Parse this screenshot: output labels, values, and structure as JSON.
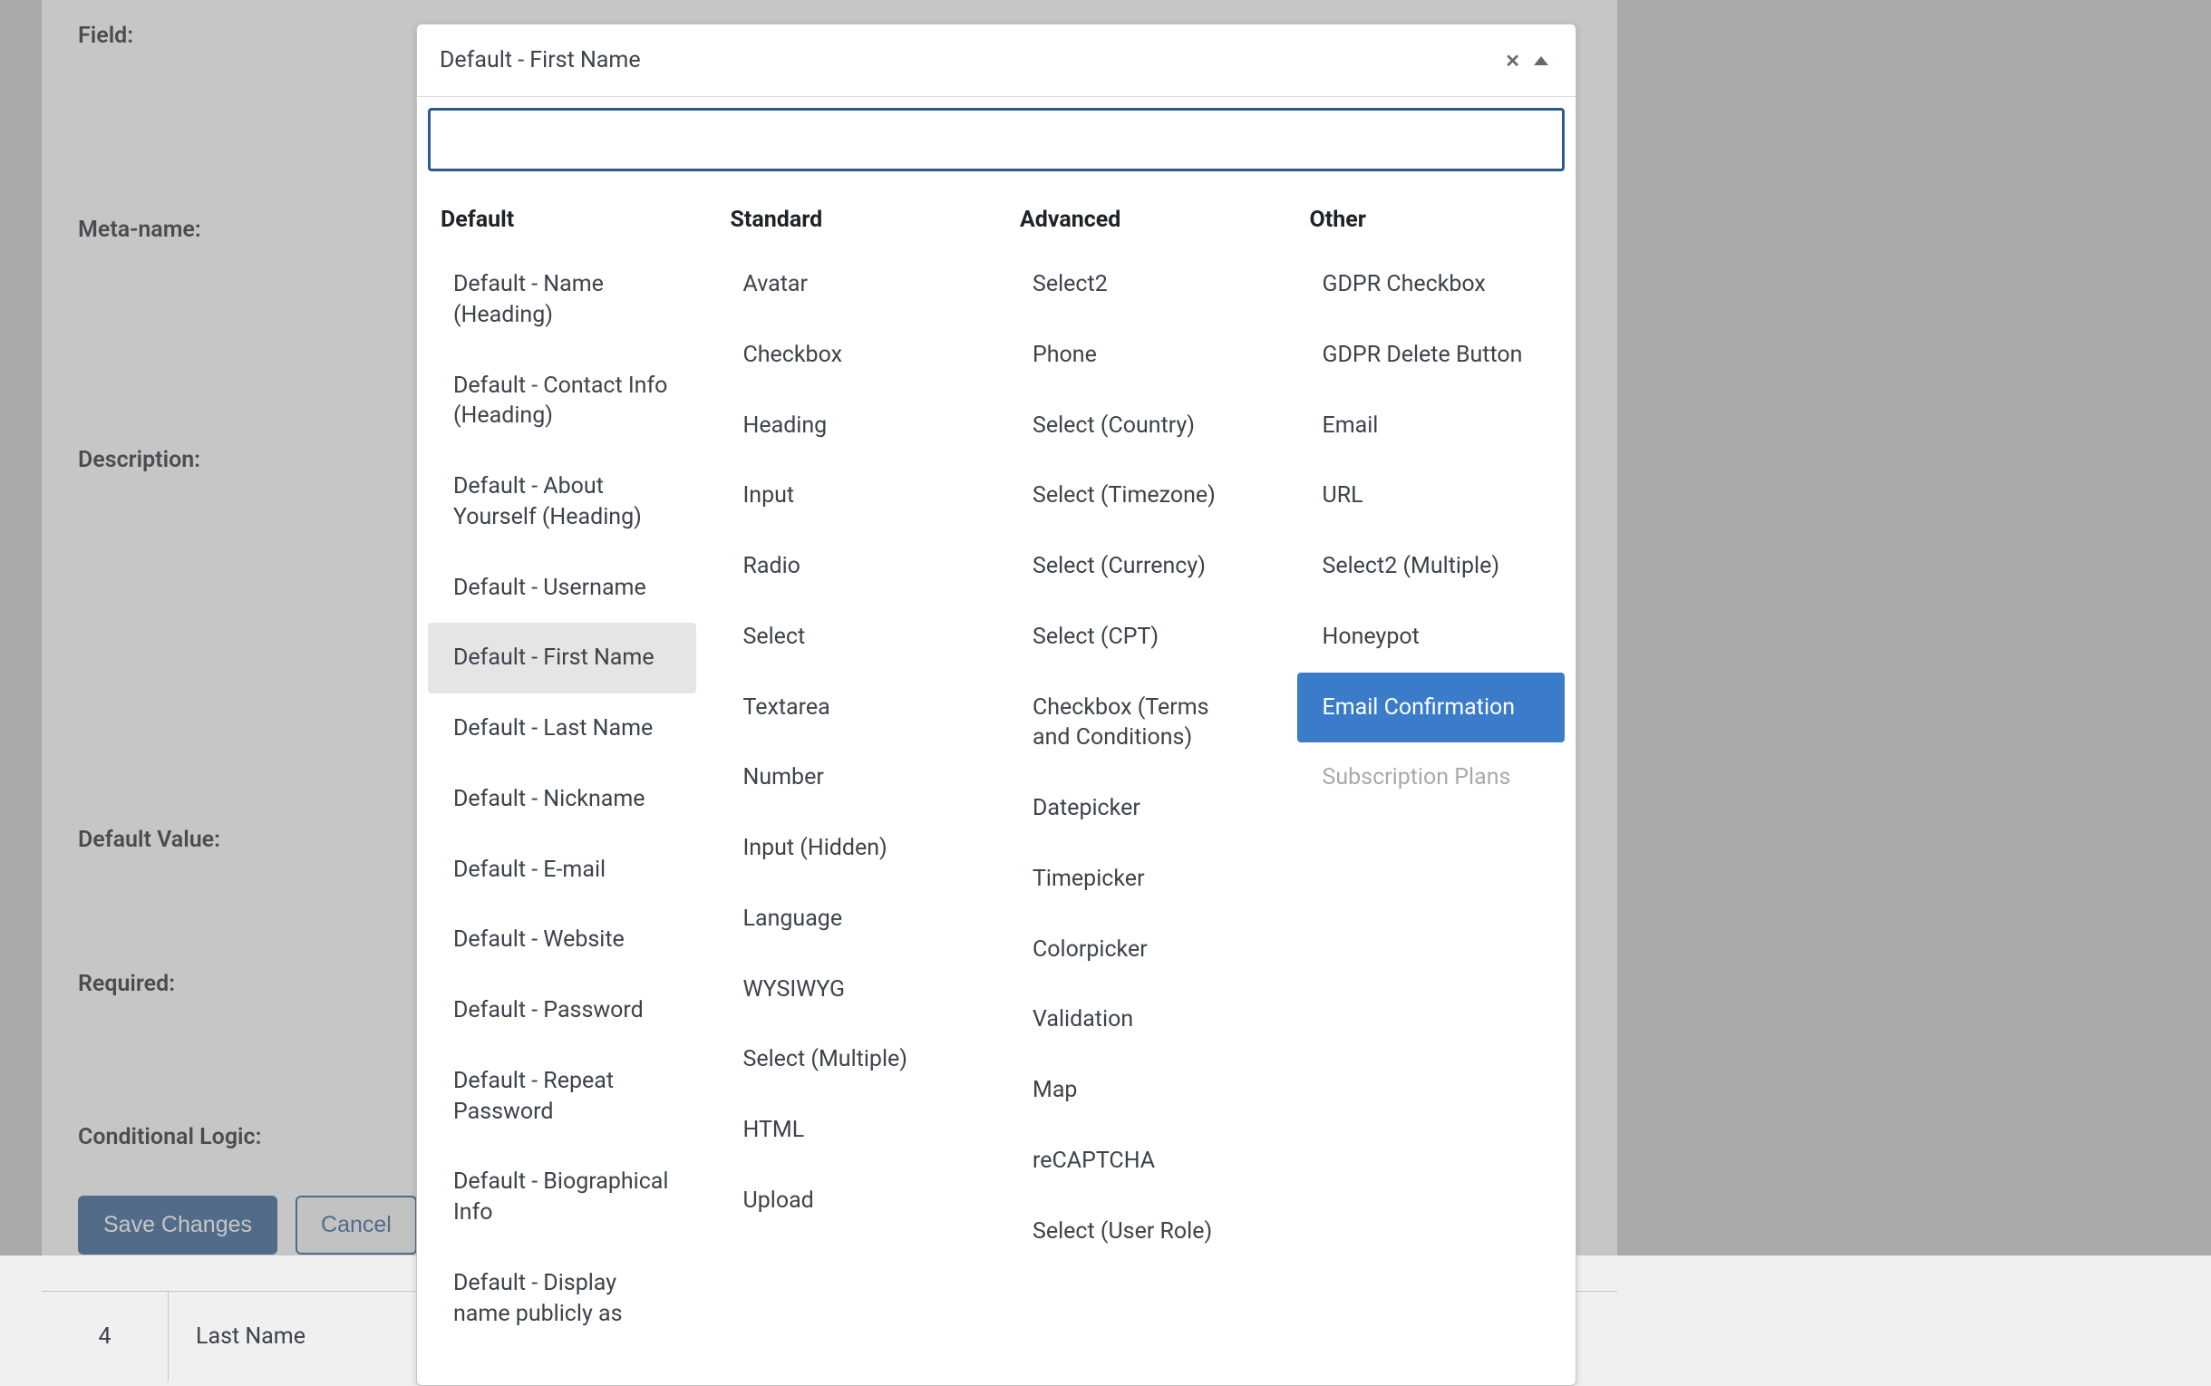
{
  "form": {
    "field_label": "Field:",
    "meta_label": "Meta-name:",
    "description_label": "Description:",
    "default_value_label": "Default Value:",
    "required_label": "Required:",
    "conditional_logic_label": "Conditional Logic:",
    "save_button": "Save Changes",
    "cancel_button": "Cancel"
  },
  "table": {
    "row_num": "4",
    "row_name": "Last Name"
  },
  "dropdown": {
    "current_value": "Default - First Name",
    "search_value": "",
    "columns": [
      {
        "header": "Default",
        "items": [
          {
            "label": "Default - Name (Heading)",
            "state": "normal"
          },
          {
            "label": "Default - Contact Info (Heading)",
            "state": "normal"
          },
          {
            "label": "Default - About Yourself (Heading)",
            "state": "normal"
          },
          {
            "label": "Default - Username",
            "state": "normal"
          },
          {
            "label": "Default - First Name",
            "state": "selected"
          },
          {
            "label": "Default - Last Name",
            "state": "normal"
          },
          {
            "label": "Default - Nickname",
            "state": "normal"
          },
          {
            "label": "Default - E-mail",
            "state": "normal"
          },
          {
            "label": "Default - Website",
            "state": "normal"
          },
          {
            "label": "Default - Password",
            "state": "normal"
          },
          {
            "label": "Default - Repeat Password",
            "state": "normal"
          },
          {
            "label": "Default - Biographical Info",
            "state": "normal"
          },
          {
            "label": "Default - Display name publicly as",
            "state": "normal"
          }
        ]
      },
      {
        "header": "Standard",
        "items": [
          {
            "label": "Avatar",
            "state": "normal"
          },
          {
            "label": "Checkbox",
            "state": "normal"
          },
          {
            "label": "Heading",
            "state": "normal"
          },
          {
            "label": "Input",
            "state": "normal"
          },
          {
            "label": "Radio",
            "state": "normal"
          },
          {
            "label": "Select",
            "state": "normal"
          },
          {
            "label": "Textarea",
            "state": "normal"
          },
          {
            "label": "Number",
            "state": "normal"
          },
          {
            "label": "Input (Hidden)",
            "state": "normal"
          },
          {
            "label": "Language",
            "state": "normal"
          },
          {
            "label": "WYSIWYG",
            "state": "normal"
          },
          {
            "label": "Select (Multiple)",
            "state": "normal"
          },
          {
            "label": "HTML",
            "state": "normal"
          },
          {
            "label": "Upload",
            "state": "normal"
          }
        ]
      },
      {
        "header": "Advanced",
        "items": [
          {
            "label": "Select2",
            "state": "normal"
          },
          {
            "label": "Phone",
            "state": "normal"
          },
          {
            "label": "Select (Country)",
            "state": "normal"
          },
          {
            "label": "Select (Timezone)",
            "state": "normal"
          },
          {
            "label": "Select (Currency)",
            "state": "normal"
          },
          {
            "label": "Select (CPT)",
            "state": "normal"
          },
          {
            "label": "Checkbox (Terms and Conditions)",
            "state": "normal"
          },
          {
            "label": "Datepicker",
            "state": "normal"
          },
          {
            "label": "Timepicker",
            "state": "normal"
          },
          {
            "label": "Colorpicker",
            "state": "normal"
          },
          {
            "label": "Validation",
            "state": "normal"
          },
          {
            "label": "Map",
            "state": "normal"
          },
          {
            "label": "reCAPTCHA",
            "state": "normal"
          },
          {
            "label": "Select (User Role)",
            "state": "normal"
          }
        ]
      },
      {
        "header": "Other",
        "items": [
          {
            "label": "GDPR Checkbox",
            "state": "normal"
          },
          {
            "label": "GDPR Delete Button",
            "state": "normal"
          },
          {
            "label": "Email",
            "state": "normal"
          },
          {
            "label": "URL",
            "state": "normal"
          },
          {
            "label": "Select2 (Multiple)",
            "state": "normal"
          },
          {
            "label": "Honeypot",
            "state": "normal"
          },
          {
            "label": "Email Confirmation",
            "state": "highlighted"
          },
          {
            "label": "Subscription Plans",
            "state": "disabled"
          }
        ]
      }
    ]
  }
}
